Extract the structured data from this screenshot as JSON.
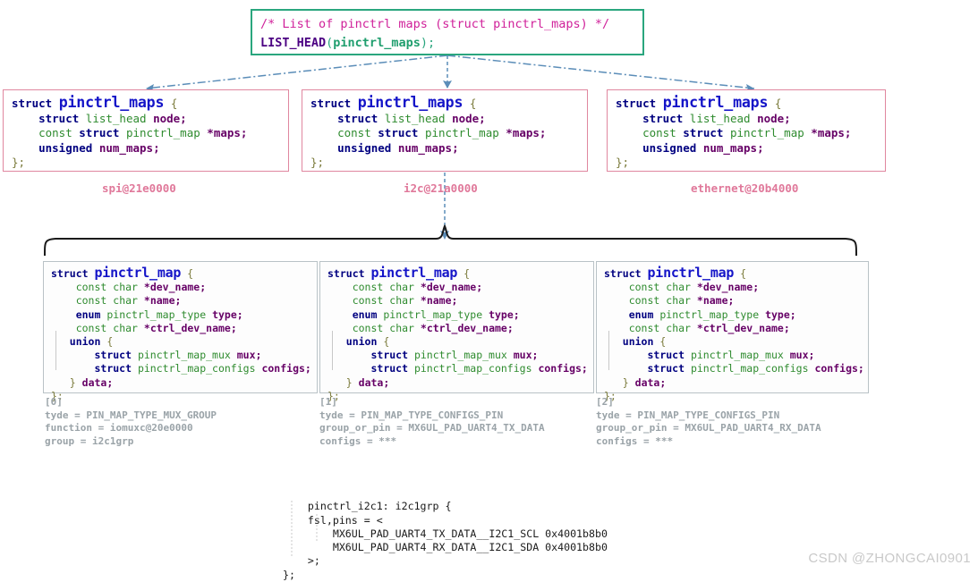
{
  "head_box": {
    "comment": "/* List of pinctrl maps (struct pinctrl_maps) */",
    "macro": "LIST_HEAD",
    "open_paren": "(",
    "arg": "pinctrl_maps",
    "close": ");"
  },
  "maps_struct": {
    "line1_kw": "struct",
    "line1_name": "pinctrl_maps",
    "line1_brace": "{",
    "line2_kw": "struct",
    "line2_type": "list_head",
    "line2_field": "node;",
    "line3_const": "const",
    "line3_kw": "struct",
    "line3_type": "pinctrl_map",
    "line3_field": "*maps;",
    "line4_kw": "unsigned",
    "line4_field": "num_maps;",
    "line5_close": "};"
  },
  "map_struct": {
    "line1_kw": "struct",
    "line1_name": "pinctrl_map",
    "line1_brace": "{",
    "rows": [
      {
        "const": "const",
        "type": "char",
        "field": "*dev_name;"
      },
      {
        "const": "const",
        "type": "char",
        "field": "*name;"
      },
      {
        "const": "enum",
        "type": "pinctrl_map_type",
        "field": "type;"
      },
      {
        "const": "const",
        "type": "char",
        "field": "*ctrl_dev_name;"
      }
    ],
    "union_kw": "union",
    "union_brace": "{",
    "union_rows": [
      {
        "kw": "struct",
        "type": "pinctrl_map_mux",
        "field": "mux;"
      },
      {
        "kw": "struct",
        "type": "pinctrl_map_configs",
        "field": "configs;"
      }
    ],
    "union_close": "}",
    "union_field": "data;",
    "line_close": "};"
  },
  "node_labels": [
    "spi@21e0000",
    "i2c@21a0000",
    "ethernet@20b4000"
  ],
  "annotations": [
    {
      "index": "[0]",
      "lines": [
        "tyde = PIN_MAP_TYPE_MUX_GROUP",
        "function = iomuxc@20e0000",
        "group = i2c1grp"
      ]
    },
    {
      "index": "[1]",
      "lines": [
        "tyde = PIN_MAP_TYPE_CONFIGS_PIN",
        "group_or_pin = MX6UL_PAD_UART4_TX_DATA",
        "configs = ***"
      ]
    },
    {
      "index": "[2]",
      "lines": [
        "tyde = PIN_MAP_TYPE_CONFIGS_PIN",
        "group_or_pin = MX6UL_PAD_UART4_RX_DATA",
        "configs = ***"
      ]
    }
  ],
  "dts": {
    "lines": [
      "pinctrl_i2c1: i2c1grp {",
      "    fsl,pins = <",
      "        MX6UL_PAD_UART4_TX_DATA__I2C1_SCL 0x4001b8b0",
      "        MX6UL_PAD_UART4_RX_DATA__I2C1_SDA 0x4001b8b0",
      "    >;",
      "};"
    ]
  },
  "watermark": "CSDN @ZHONGCAI0901",
  "colors": {
    "head_border": "#2aa67e",
    "maps_border": "#e0879f",
    "map_border": "#b9c2c6",
    "connector": "#5b8db8",
    "brace": "#1a1a1a",
    "node_label": "#e0789a",
    "annotation": "#9aa3a8",
    "watermark": "#c9c9c9"
  }
}
